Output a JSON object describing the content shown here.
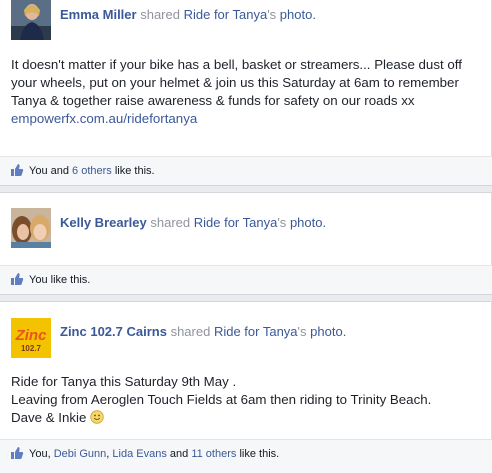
{
  "posts": [
    {
      "author": "Emma Miller",
      "verb": "shared",
      "page": "Ride for Tanya",
      "possessive": "'s",
      "object": "photo.",
      "text": "It doesn't matter if your bike has a bell, basket or streamers... Please dust off your wheels, put on your helmet & join us this Saturday at 6am to remember Tanya & together raise awareness & funds for safety on our roads xx",
      "url": "empowerfx.com.au/ridefortanya",
      "likes": {
        "prefix": "You and",
        "link1": "6 others",
        "suffix": "like this."
      }
    },
    {
      "author": "Kelly Brearley",
      "verb": "shared",
      "page": "Ride for Tanya",
      "possessive": "'s",
      "object": "photo.",
      "likes": {
        "prefix": "You like this."
      }
    },
    {
      "author": "Zinc 102.7 Cairns",
      "verb": "shared",
      "page": "Ride for Tanya",
      "possessive": "'s",
      "object": "photo.",
      "text_lines": [
        "Ride for Tanya this Saturday 9th May .",
        "Leaving from Aeroglen Touch Fields at 6am then riding to Trinity Beach.",
        "Dave & Inkie"
      ],
      "emoji": "smile-emoji",
      "likes": {
        "prefix": "You,",
        "link1": "Debi Gunn",
        "comma": ",",
        "link2": "Lida Evans",
        "and": "and",
        "link3": "11 others",
        "suffix": "like this."
      },
      "logo_text": "Zinc",
      "logo_sub": "102.7"
    }
  ],
  "icons": [
    "like-thumb-icon",
    "avatar-photo"
  ],
  "colors": {
    "link": "#3b5998",
    "muted": "#90949c",
    "footer_bg": "#f6f7f9",
    "separator": "#e9ebee",
    "logo_yellow": "#f4c300",
    "logo_orange": "#e8531e"
  }
}
